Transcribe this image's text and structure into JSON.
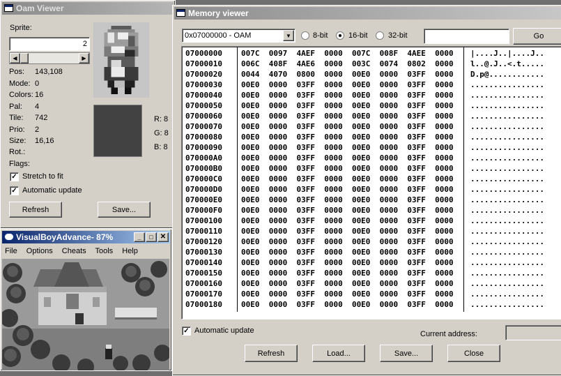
{
  "oam": {
    "title": "Oam Viewer",
    "sprite_label": "Sprite:",
    "sprite_value": "2",
    "props": [
      {
        "label": "Pos:",
        "value": "143,108"
      },
      {
        "label": "Mode:",
        "value": "0"
      },
      {
        "label": "Colors:",
        "value": "16"
      },
      {
        "label": "Pal:",
        "value": "4"
      },
      {
        "label": "Tile:",
        "value": "742"
      },
      {
        "label": "Prio:",
        "value": "2"
      },
      {
        "label": "Size:",
        "value": "16,16"
      },
      {
        "label": "Rot.:",
        "value": ""
      },
      {
        "label": "Flags:",
        "value": ""
      }
    ],
    "rgb": {
      "r": "R: 8",
      "g": "G: 8",
      "b": "B: 8"
    },
    "stretch_label": "Stretch to fit",
    "auto_label": "Automatic update",
    "refresh": "Refresh",
    "save": "Save...",
    "swatch_color": "#424242"
  },
  "vba": {
    "title": "VisualBoyAdvance- 87%",
    "menu": [
      "File",
      "Options",
      "Cheats",
      "Tools",
      "Help"
    ]
  },
  "mem": {
    "title": "Memory viewer",
    "select_value": "0x07000000 - OAM",
    "radios": [
      {
        "label": "8-bit",
        "on": false
      },
      {
        "label": "16-bit",
        "on": true
      },
      {
        "label": "32-bit",
        "on": false
      }
    ],
    "go": "Go",
    "rows": [
      {
        "addr": "07000000",
        "hex": "007C  0097  4AEF  0000  007C  008F  4AEE  0000",
        "ascii": "|....J..|....J.."
      },
      {
        "addr": "07000010",
        "hex": "006C  408F  4AE6  0000  003C  0074  0802  0000",
        "ascii": "l..@.J..<.t....."
      },
      {
        "addr": "07000020",
        "hex": "0044  4070  0800  0000  00E0  0000  03FF  0000",
        "ascii": "D.p@............"
      },
      {
        "addr": "07000030",
        "hex": "00E0  0000  03FF  0000  00E0  0000  03FF  0000",
        "ascii": "................"
      },
      {
        "addr": "07000040",
        "hex": "00E0  0000  03FF  0000  00E0  0000  03FF  0000",
        "ascii": "................"
      },
      {
        "addr": "07000050",
        "hex": "00E0  0000  03FF  0000  00E0  0000  03FF  0000",
        "ascii": "................"
      },
      {
        "addr": "07000060",
        "hex": "00E0  0000  03FF  0000  00E0  0000  03FF  0000",
        "ascii": "................"
      },
      {
        "addr": "07000070",
        "hex": "00E0  0000  03FF  0000  00E0  0000  03FF  0000",
        "ascii": "................"
      },
      {
        "addr": "07000080",
        "hex": "00E0  0000  03FF  0000  00E0  0000  03FF  0000",
        "ascii": "................"
      },
      {
        "addr": "07000090",
        "hex": "00E0  0000  03FF  0000  00E0  0000  03FF  0000",
        "ascii": "................"
      },
      {
        "addr": "070000A0",
        "hex": "00E0  0000  03FF  0000  00E0  0000  03FF  0000",
        "ascii": "................"
      },
      {
        "addr": "070000B0",
        "hex": "00E0  0000  03FF  0000  00E0  0000  03FF  0000",
        "ascii": "................"
      },
      {
        "addr": "070000C0",
        "hex": "00E0  0000  03FF  0000  00E0  0000  03FF  0000",
        "ascii": "................"
      },
      {
        "addr": "070000D0",
        "hex": "00E0  0000  03FF  0000  00E0  0000  03FF  0000",
        "ascii": "................"
      },
      {
        "addr": "070000E0",
        "hex": "00E0  0000  03FF  0000  00E0  0000  03FF  0000",
        "ascii": "................"
      },
      {
        "addr": "070000F0",
        "hex": "00E0  0000  03FF  0000  00E0  0000  03FF  0000",
        "ascii": "................"
      },
      {
        "addr": "07000100",
        "hex": "00E0  0000  03FF  0000  00E0  0000  03FF  0000",
        "ascii": "................"
      },
      {
        "addr": "07000110",
        "hex": "00E0  0000  03FF  0000  00E0  0000  03FF  0000",
        "ascii": "................"
      },
      {
        "addr": "07000120",
        "hex": "00E0  0000  03FF  0000  00E0  0000  03FF  0000",
        "ascii": "................"
      },
      {
        "addr": "07000130",
        "hex": "00E0  0000  03FF  0000  00E0  0000  03FF  0000",
        "ascii": "................"
      },
      {
        "addr": "07000140",
        "hex": "00E0  0000  03FF  0000  00E0  0000  03FF  0000",
        "ascii": "................"
      },
      {
        "addr": "07000150",
        "hex": "00E0  0000  03FF  0000  00E0  0000  03FF  0000",
        "ascii": "................"
      },
      {
        "addr": "07000160",
        "hex": "00E0  0000  03FF  0000  00E0  0000  03FF  0000",
        "ascii": "................"
      },
      {
        "addr": "07000170",
        "hex": "00E0  0000  03FF  0000  00E0  0000  03FF  0000",
        "ascii": "................"
      },
      {
        "addr": "07000180",
        "hex": "00E0  0000  03FF  0000  00E0  0000  03FF  0000",
        "ascii": "................"
      }
    ],
    "auto_label": "Automatic update",
    "current_label": "Current address:",
    "buttons": {
      "refresh": "Refresh",
      "load": "Load...",
      "save": "Save...",
      "close": "Close"
    }
  }
}
